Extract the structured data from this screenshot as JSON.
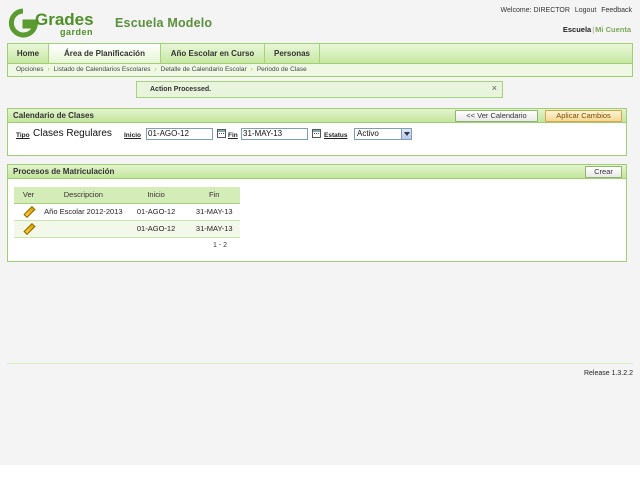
{
  "header": {
    "logo_text": "Grades",
    "logo_sub": "garden",
    "school_name": "Escuela Modelo",
    "welcome": "Welcome: DIRECTOR",
    "logout": "Logout",
    "feedback": "Feedback",
    "school_link": "Escuela",
    "account_link": "Mi Cuenta"
  },
  "nav": {
    "tabs": [
      {
        "label": "Home"
      },
      {
        "label": "Área de Planificación"
      },
      {
        "label": "Año Escolar en Curso"
      },
      {
        "label": "Personas"
      }
    ],
    "active_tab": "Área de Planificación"
  },
  "breadcrumb": {
    "items": [
      "Opciones",
      "Listado de Calendarios Escolares",
      "Detalle de Calendario Escolar",
      "Periodo de Clase"
    ]
  },
  "alert": {
    "message": "Action Processed.",
    "close": "×"
  },
  "calendar_panel": {
    "title": "Calendario de Clases",
    "back_button": "<< Ver Calendario",
    "apply_button": "Aplicar Cambios",
    "tipo_label": "Tipo",
    "tipo_value": "Clases Regulares",
    "inicio_label": "Inicio",
    "inicio_value": "01-AGO-12",
    "fin_label": "Fin",
    "fin_value": "31-MAY-13",
    "estatus_label": "Estatus",
    "estatus_value": "Activo"
  },
  "enrollment_panel": {
    "title": "Procesos de Matriculación",
    "create_button": "Crear",
    "columns": [
      "Ver",
      "Descripcion",
      "Inicio",
      "Fin"
    ],
    "rows": [
      {
        "descripcion": "Año Escolar 2012-2013",
        "inicio": "01-AGO-12",
        "fin": "31-MAY-13"
      },
      {
        "descripcion": "",
        "inicio": "01-AGO-12",
        "fin": "31-MAY-13"
      }
    ],
    "pager": "1 - 2"
  },
  "footer": {
    "release": "Release 1.3.2.2"
  }
}
